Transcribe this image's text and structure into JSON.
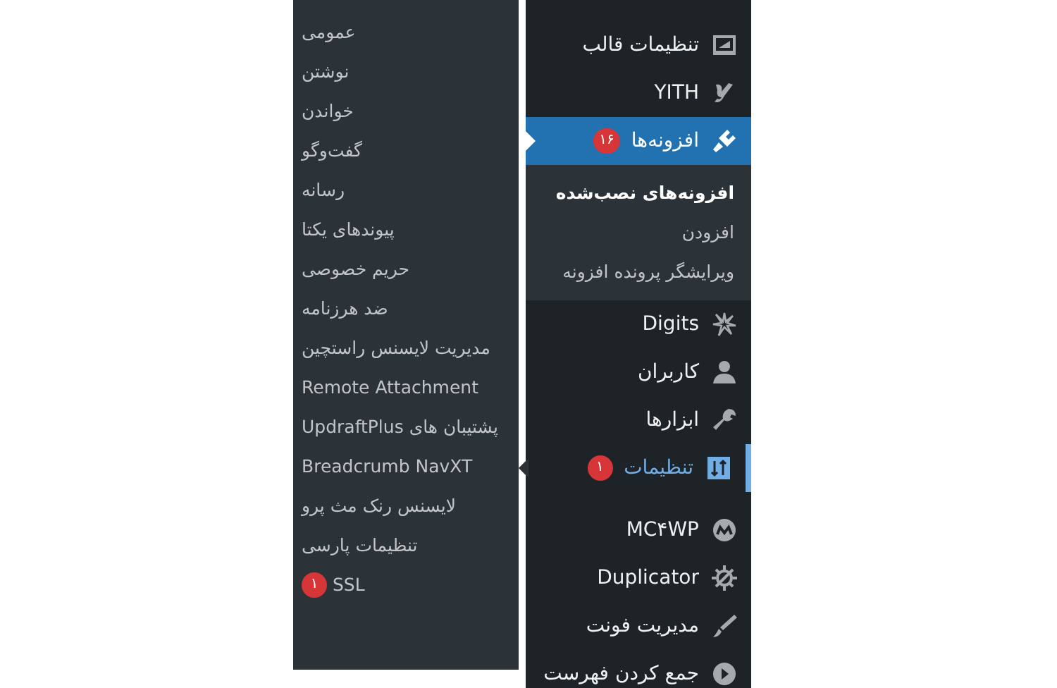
{
  "flyout": {
    "items": [
      {
        "label": "عمومی"
      },
      {
        "label": "نوشتن"
      },
      {
        "label": "خواندن"
      },
      {
        "label": "گفت‌وگو"
      },
      {
        "label": "رسانه"
      },
      {
        "label": "پیوندهای یکتا"
      },
      {
        "label": "حریم خصوصی"
      },
      {
        "label": "ضد هرزنامه"
      },
      {
        "label": "مدیریت لایسنس راستچین"
      },
      {
        "label": "Remote Attachment"
      },
      {
        "label": "پشتیبان های UpdraftPlus"
      },
      {
        "label": "Breadcrumb NavXT"
      },
      {
        "label": "لایسنس رنک مث پرو"
      },
      {
        "label": "تنظیمات پارسی"
      },
      {
        "label": "SSL",
        "badge": "۱"
      }
    ]
  },
  "sidebar": {
    "sections": [
      {
        "items": [
          {
            "label": "تنظیمات قالب",
            "selected": false,
            "flyout_open": false
          },
          {
            "label": "YITH",
            "selected": false,
            "flyout_open": false
          },
          {
            "label": "افزونه‌ها",
            "badge": "۱۶",
            "selected": true,
            "flyout_open": false,
            "children": [
              {
                "label": "افزونه‌های نصب‌شده",
                "selected": true
              },
              {
                "label": "افزودن",
                "selected": false
              },
              {
                "label": "ویرایشگر پرونده افزونه",
                "selected": false
              }
            ]
          },
          {
            "label": "Digits",
            "selected": false,
            "flyout_open": false
          },
          {
            "label": "کاربران",
            "selected": false,
            "flyout_open": false
          },
          {
            "label": "ابزارها",
            "selected": false,
            "flyout_open": false
          },
          {
            "label": "تنظیمات",
            "badge": "۱",
            "selected": false,
            "flyout_open": true
          }
        ]
      },
      {
        "items": [
          {
            "label": "MC۴WP",
            "selected": false,
            "flyout_open": false
          },
          {
            "label": "Duplicator",
            "selected": false,
            "flyout_open": false
          },
          {
            "label": "مدیریت فونت",
            "selected": false,
            "flyout_open": false
          },
          {
            "label": "جمع کردن فهرست",
            "selected": false,
            "flyout_open": false
          }
        ]
      }
    ]
  }
}
